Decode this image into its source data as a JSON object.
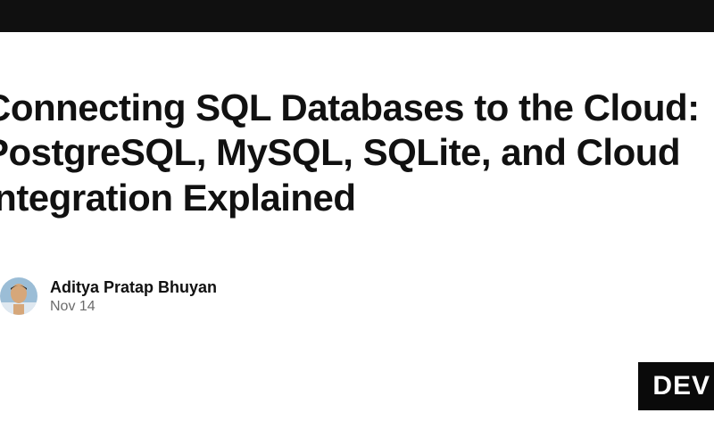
{
  "article": {
    "title": "Connecting SQL Databases to the Cloud: PostgreSQL, MySQL, SQLite, and Cloud Integration Explained"
  },
  "author": {
    "name": "Aditya Pratap Bhuyan",
    "date": "Nov 14"
  },
  "badge": {
    "text": "DEV"
  }
}
